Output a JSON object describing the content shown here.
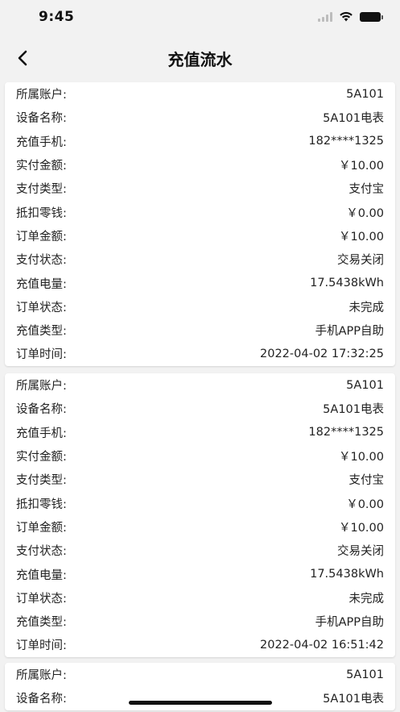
{
  "status_bar": {
    "time": "9:45",
    "signal_icon": "cellular-signal-icon",
    "wifi_icon": "wifi-icon",
    "battery_icon": "battery-icon"
  },
  "nav": {
    "title": "充值流水",
    "back_icon": "chevron-left-icon"
  },
  "records": [
    {
      "rows": [
        {
          "label": "所属账户:",
          "value": "5A101"
        },
        {
          "label": "设备名称:",
          "value": "5A101电表"
        },
        {
          "label": "充值手机:",
          "value": "182****1325"
        },
        {
          "label": "实付金额:",
          "value": "￥10.00"
        },
        {
          "label": "支付类型:",
          "value": "支付宝"
        },
        {
          "label": "抵扣零钱:",
          "value": "￥0.00"
        },
        {
          "label": "订单金额:",
          "value": "￥10.00"
        },
        {
          "label": "支付状态:",
          "value": "交易关闭"
        },
        {
          "label": "充值电量:",
          "value": "17.5438kWh"
        },
        {
          "label": "订单状态:",
          "value": "未完成"
        },
        {
          "label": "充值类型:",
          "value": "手机APP自助"
        },
        {
          "label": "订单时间:",
          "value": "2022-04-02 17:32:25"
        }
      ]
    },
    {
      "rows": [
        {
          "label": "所属账户:",
          "value": "5A101"
        },
        {
          "label": "设备名称:",
          "value": "5A101电表"
        },
        {
          "label": "充值手机:",
          "value": "182****1325"
        },
        {
          "label": "实付金额:",
          "value": "￥10.00"
        },
        {
          "label": "支付类型:",
          "value": "支付宝"
        },
        {
          "label": "抵扣零钱:",
          "value": "￥0.00"
        },
        {
          "label": "订单金额:",
          "value": "￥10.00"
        },
        {
          "label": "支付状态:",
          "value": "交易关闭"
        },
        {
          "label": "充值电量:",
          "value": "17.5438kWh"
        },
        {
          "label": "订单状态:",
          "value": "未完成"
        },
        {
          "label": "充值类型:",
          "value": "手机APP自助"
        },
        {
          "label": "订单时间:",
          "value": "2022-04-02 16:51:42"
        }
      ]
    },
    {
      "rows": [
        {
          "label": "所属账户:",
          "value": "5A101"
        },
        {
          "label": "设备名称:",
          "value": "5A101电表"
        }
      ]
    }
  ]
}
